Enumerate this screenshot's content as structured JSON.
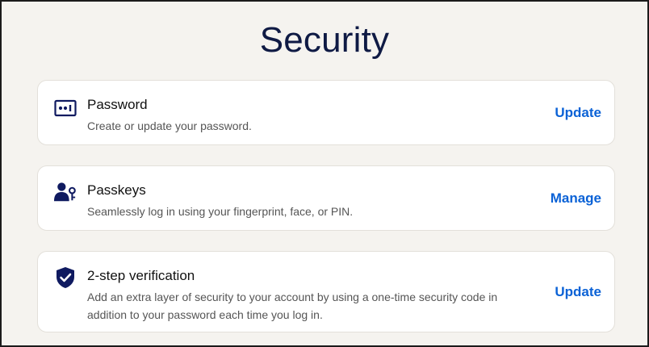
{
  "page": {
    "title": "Security"
  },
  "cards": [
    {
      "icon": "password-icon",
      "title": "Password",
      "description": "Create or update your password.",
      "action": "Update"
    },
    {
      "icon": "passkey-icon",
      "title": "Passkeys",
      "description": "Seamlessly log in using your fingerprint, face, or PIN.",
      "action": "Manage"
    },
    {
      "icon": "shield-check-icon",
      "title": "2-step verification",
      "description": "Add an extra layer of security to your account by using a one-time security code in addition to your password each time you log in.",
      "action": "Update"
    }
  ],
  "colors": {
    "background": "#f5f3ef",
    "title": "#0f1a44",
    "icon": "#0f1a60",
    "link": "#0b62d6"
  }
}
